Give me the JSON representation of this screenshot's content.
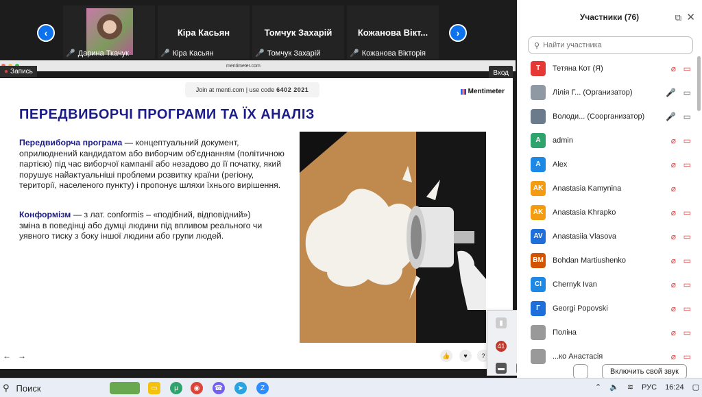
{
  "gallery": {
    "prev_arrow": "‹",
    "next_arrow": "›",
    "tiles": [
      {
        "label": "Дарина Ткачук"
      },
      {
        "name": "Кіра Касьян",
        "label": "Кіра Касьян"
      },
      {
        "name": "Томчук Захарій",
        "label": "Томчук Захарій"
      },
      {
        "name": "Кожанова Вікт...",
        "label": "Кожанова Вікторія"
      }
    ]
  },
  "share": {
    "url": "mentimeter.com",
    "record_label": "Запись",
    "login_label": "Вход"
  },
  "slide": {
    "join_text": "Join at menti.com | use code",
    "join_code": "6402 2021",
    "logo": "Mentimeter",
    "title": "ПЕРЕДВИБОРЧІ ПРОГРАМИ ТА ЇХ АНАЛІЗ",
    "p1_term": "Передвиборча програма",
    "p1_text": " — концептуальний документ, оприлюднений кандидатом або виборчим об'єднанням (політичною партією) під час виборчої кампанії або незадово до її початку, який порушує найактуальніші проблеми розвитку країни (регіону, території, населеного пункту) і пропонує шляхи їхнього вирішення.",
    "p2_term": "Конформізм",
    "p2_text": " — з лат. conformis – «подібний, відповідний») зміна в поведінці або думці людини під впливом реального чи уявного тиску з боку іншої людини або групи людей.",
    "nav_prev": "←",
    "nav_next": "→"
  },
  "panel": {
    "title": "Участники (76)",
    "search_placeholder": "Найти участника",
    "participants": [
      {
        "initials": "T",
        "name": "Тетяна Кот (Я)",
        "color": "#e53935"
      },
      {
        "initials": "",
        "name": "Лілія Г...  (Организатор)",
        "color": "#8e99a4"
      },
      {
        "initials": "",
        "name": "Володи...  (Соорганизатор)",
        "color": "#6b7b8c"
      },
      {
        "initials": "A",
        "name": "admin",
        "color": "#2ea36b"
      },
      {
        "initials": "A",
        "name": "Alex",
        "color": "#1e88e5"
      },
      {
        "initials": "AK",
        "name": "Anastasia Kamynina",
        "color": "#f39c12"
      },
      {
        "initials": "AK",
        "name": "Anastasia Khrapko",
        "color": "#f39c12"
      },
      {
        "initials": "AV",
        "name": "Anastasiia Vlasova",
        "color": "#1e6fd9"
      },
      {
        "initials": "BM",
        "name": "Bohdan Martiushenko",
        "color": "#d35400"
      },
      {
        "initials": "CI",
        "name": "Chernyk Ivan",
        "color": "#1e88e5"
      },
      {
        "initials": "Г",
        "name": "Georgi Popovski",
        "color": "#1e6fd9"
      },
      {
        "initials": "",
        "name": "Поліна",
        "color": "#999999"
      },
      {
        "initials": "",
        "name": "...ко Анастасія",
        "color": "#999999"
      }
    ],
    "unmute_label": "Включить свой звук"
  },
  "taskbar": {
    "search_label": "Поиск",
    "lang": "РУС",
    "time": "16:24"
  },
  "colors": {
    "zoom_blue": "#0e72ed",
    "mic_off_red": "#e03e3e",
    "slide_title": "#1b1b8a"
  }
}
